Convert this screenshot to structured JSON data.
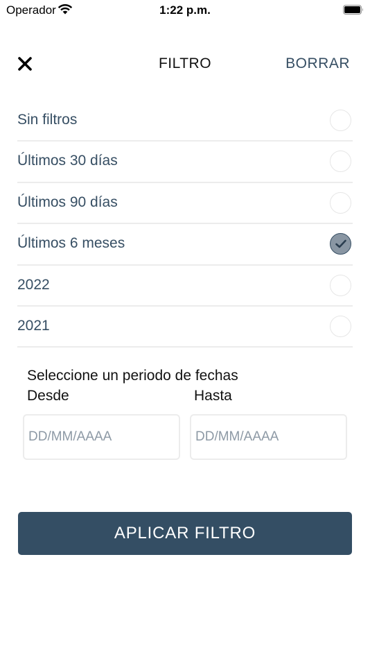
{
  "status_bar": {
    "carrier": "Operador",
    "time": "1:22 p.m.",
    "wifi_icon": "wifi-icon",
    "battery_icon": "battery-icon"
  },
  "header": {
    "close_icon": "close-icon",
    "title": "FILTRO",
    "clear_label": "BORRAR"
  },
  "options": [
    {
      "label": "Sin filtros",
      "selected": false
    },
    {
      "label": "Últimos 30 días",
      "selected": false
    },
    {
      "label": "Últimos 90 días",
      "selected": false
    },
    {
      "label": "Últimos 6 meses",
      "selected": true
    },
    {
      "label": "2022",
      "selected": false
    },
    {
      "label": "2021",
      "selected": false
    }
  ],
  "date_range": {
    "title": "Seleccione un periodo de fechas",
    "from_label": "Desde",
    "to_label": "Hasta",
    "from_placeholder": "DD/MM/AAAA",
    "to_placeholder": "DD/MM/AAAA",
    "from_value": "",
    "to_value": ""
  },
  "apply_button": {
    "label": "APLICAR FILTRO"
  },
  "colors": {
    "accent": "#344e64",
    "option_text": "#364e63",
    "checked_fill": "#8996a3",
    "divider": "#ececec"
  }
}
